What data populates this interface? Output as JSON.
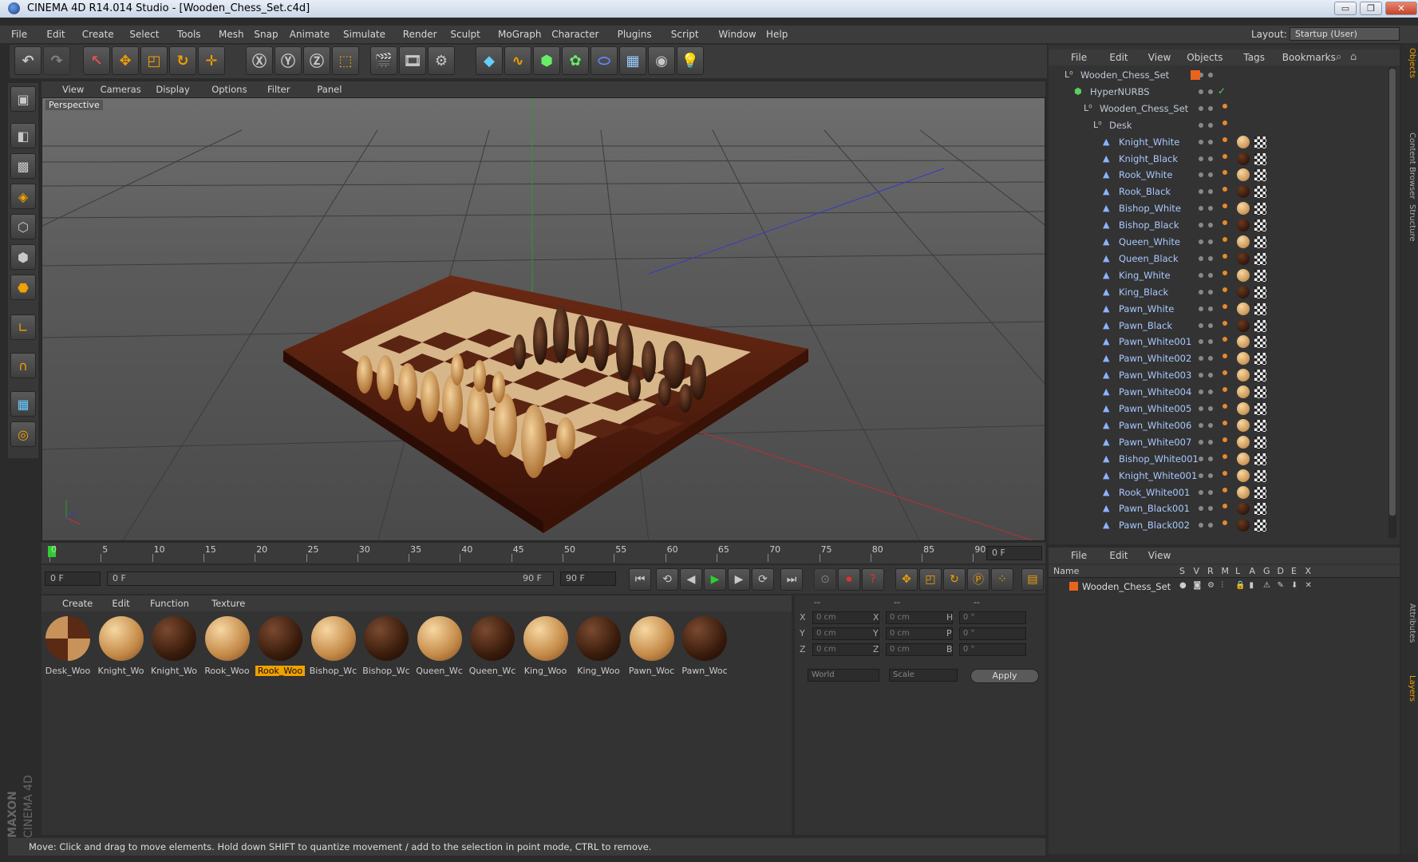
{
  "window": {
    "title": "CINEMA 4D R14.014 Studio - [Wooden_Chess_Set.c4d]",
    "min": "▭",
    "max": "❐",
    "close": "✕"
  },
  "menubar": {
    "items": [
      "File",
      "Edit",
      "Create",
      "Select",
      "Tools",
      "Mesh",
      "Snap",
      "Animate",
      "Simulate",
      "Render",
      "Sculpt",
      "MoGraph",
      "Character",
      "Plugins",
      "Script",
      "Window",
      "Help"
    ],
    "layout_label": "Layout:",
    "layout_value": "Startup (User)"
  },
  "viewport": {
    "menu": [
      "View",
      "Cameras",
      "Display",
      "Options",
      "Filter",
      "Panel"
    ],
    "label": "Perspective"
  },
  "timeline": {
    "ticks": [
      "0",
      "5",
      "10",
      "15",
      "20",
      "25",
      "30",
      "35",
      "40",
      "45",
      "50",
      "55",
      "60",
      "65",
      "70",
      "75",
      "80",
      "85",
      "90"
    ],
    "current_frame": "0 F"
  },
  "playbar": {
    "start": "0 F",
    "range_start": "0 F",
    "range_end": "90 F",
    "end": "90 F"
  },
  "materials": {
    "menu": [
      "Create",
      "Edit",
      "Function",
      "Texture"
    ],
    "items": [
      {
        "label": "Desk_Woo",
        "type": "desk"
      },
      {
        "label": "Knight_Wo",
        "type": "white"
      },
      {
        "label": "Knight_Wo",
        "type": "black"
      },
      {
        "label": "Rook_Woo",
        "type": "white"
      },
      {
        "label": "Rook_Woo",
        "type": "black",
        "selected": true
      },
      {
        "label": "Bishop_Wc",
        "type": "white"
      },
      {
        "label": "Bishop_Wc",
        "type": "black"
      },
      {
        "label": "Queen_Wc",
        "type": "white"
      },
      {
        "label": "Queen_Wc",
        "type": "black"
      },
      {
        "label": "King_Woo",
        "type": "white"
      },
      {
        "label": "King_Woo",
        "type": "black"
      },
      {
        "label": "Pawn_Woc",
        "type": "white"
      },
      {
        "label": "Pawn_Woc",
        "type": "black"
      }
    ]
  },
  "coords": {
    "headers": [
      "--",
      "--",
      "--"
    ],
    "rows": [
      {
        "a": "X",
        "av": "0 cm",
        "b": "X",
        "bv": "0 cm",
        "c": "H",
        "cv": "0 °"
      },
      {
        "a": "Y",
        "av": "0 cm",
        "b": "Y",
        "bv": "0 cm",
        "c": "P",
        "cv": "0 °"
      },
      {
        "a": "Z",
        "av": "0 cm",
        "b": "Z",
        "bv": "0 cm",
        "c": "B",
        "cv": "0 °"
      }
    ],
    "space": "World",
    "mode": "Scale",
    "apply": "Apply"
  },
  "objects": {
    "menu": [
      "File",
      "Edit",
      "View",
      "Objects",
      "Tags",
      "Bookmarks"
    ],
    "tree": [
      {
        "name": "Wooden_Chess_Set",
        "indent": 0,
        "kind": "null"
      },
      {
        "name": "HyperNURBS",
        "indent": 1,
        "kind": "nurbs"
      },
      {
        "name": "Wooden_Chess_Set",
        "indent": 2,
        "kind": "null"
      },
      {
        "name": "Desk",
        "indent": 3,
        "kind": "null"
      },
      {
        "name": "Knight_White",
        "indent": 4,
        "kind": "mesh",
        "mat": "white"
      },
      {
        "name": "Knight_Black",
        "indent": 4,
        "kind": "mesh",
        "mat": "black"
      },
      {
        "name": "Rook_White",
        "indent": 4,
        "kind": "mesh",
        "mat": "white"
      },
      {
        "name": "Rook_Black",
        "indent": 4,
        "kind": "mesh",
        "mat": "black"
      },
      {
        "name": "Bishop_White",
        "indent": 4,
        "kind": "mesh",
        "mat": "white"
      },
      {
        "name": "Bishop_Black",
        "indent": 4,
        "kind": "mesh",
        "mat": "black"
      },
      {
        "name": "Queen_White",
        "indent": 4,
        "kind": "mesh",
        "mat": "white"
      },
      {
        "name": "Queen_Black",
        "indent": 4,
        "kind": "mesh",
        "mat": "black"
      },
      {
        "name": "King_White",
        "indent": 4,
        "kind": "mesh",
        "mat": "white"
      },
      {
        "name": "King_Black",
        "indent": 4,
        "kind": "mesh",
        "mat": "black"
      },
      {
        "name": "Pawn_White",
        "indent": 4,
        "kind": "mesh",
        "mat": "white"
      },
      {
        "name": "Pawn_Black",
        "indent": 4,
        "kind": "mesh",
        "mat": "black"
      },
      {
        "name": "Pawn_White001",
        "indent": 4,
        "kind": "mesh",
        "mat": "white"
      },
      {
        "name": "Pawn_White002",
        "indent": 4,
        "kind": "mesh",
        "mat": "white"
      },
      {
        "name": "Pawn_White003",
        "indent": 4,
        "kind": "mesh",
        "mat": "white"
      },
      {
        "name": "Pawn_White004",
        "indent": 4,
        "kind": "mesh",
        "mat": "white"
      },
      {
        "name": "Pawn_White005",
        "indent": 4,
        "kind": "mesh",
        "mat": "white"
      },
      {
        "name": "Pawn_White006",
        "indent": 4,
        "kind": "mesh",
        "mat": "white"
      },
      {
        "name": "Pawn_White007",
        "indent": 4,
        "kind": "mesh",
        "mat": "white"
      },
      {
        "name": "Bishop_White001",
        "indent": 4,
        "kind": "mesh",
        "mat": "white"
      },
      {
        "name": "Knight_White001",
        "indent": 4,
        "kind": "mesh",
        "mat": "white"
      },
      {
        "name": "Rook_White001",
        "indent": 4,
        "kind": "mesh",
        "mat": "white"
      },
      {
        "name": "Pawn_Black001",
        "indent": 4,
        "kind": "mesh",
        "mat": "black"
      },
      {
        "name": "Pawn_Black002",
        "indent": 4,
        "kind": "mesh",
        "mat": "black"
      }
    ]
  },
  "layers": {
    "menu": [
      "File",
      "Edit",
      "View"
    ],
    "columns": [
      "Name",
      "S",
      "V",
      "R",
      "M",
      "L",
      "A",
      "G",
      "D",
      "E",
      "X"
    ],
    "rows": [
      {
        "name": "Wooden_Chess_Set"
      }
    ]
  },
  "side_tabs": [
    "Objects",
    "Content Browser",
    "Structure",
    "Attributes",
    "Layers"
  ],
  "status": "Move: Click and drag to move elements. Hold down SHIFT to quantize movement / add to the selection in point mode, CTRL to remove.",
  "brand": {
    "line1": "MAXON",
    "line2": "CINEMA 4D"
  },
  "colors": {
    "accent": "#f0a000",
    "white_wood": "#d9a55a",
    "black_wood": "#3a1e10"
  }
}
